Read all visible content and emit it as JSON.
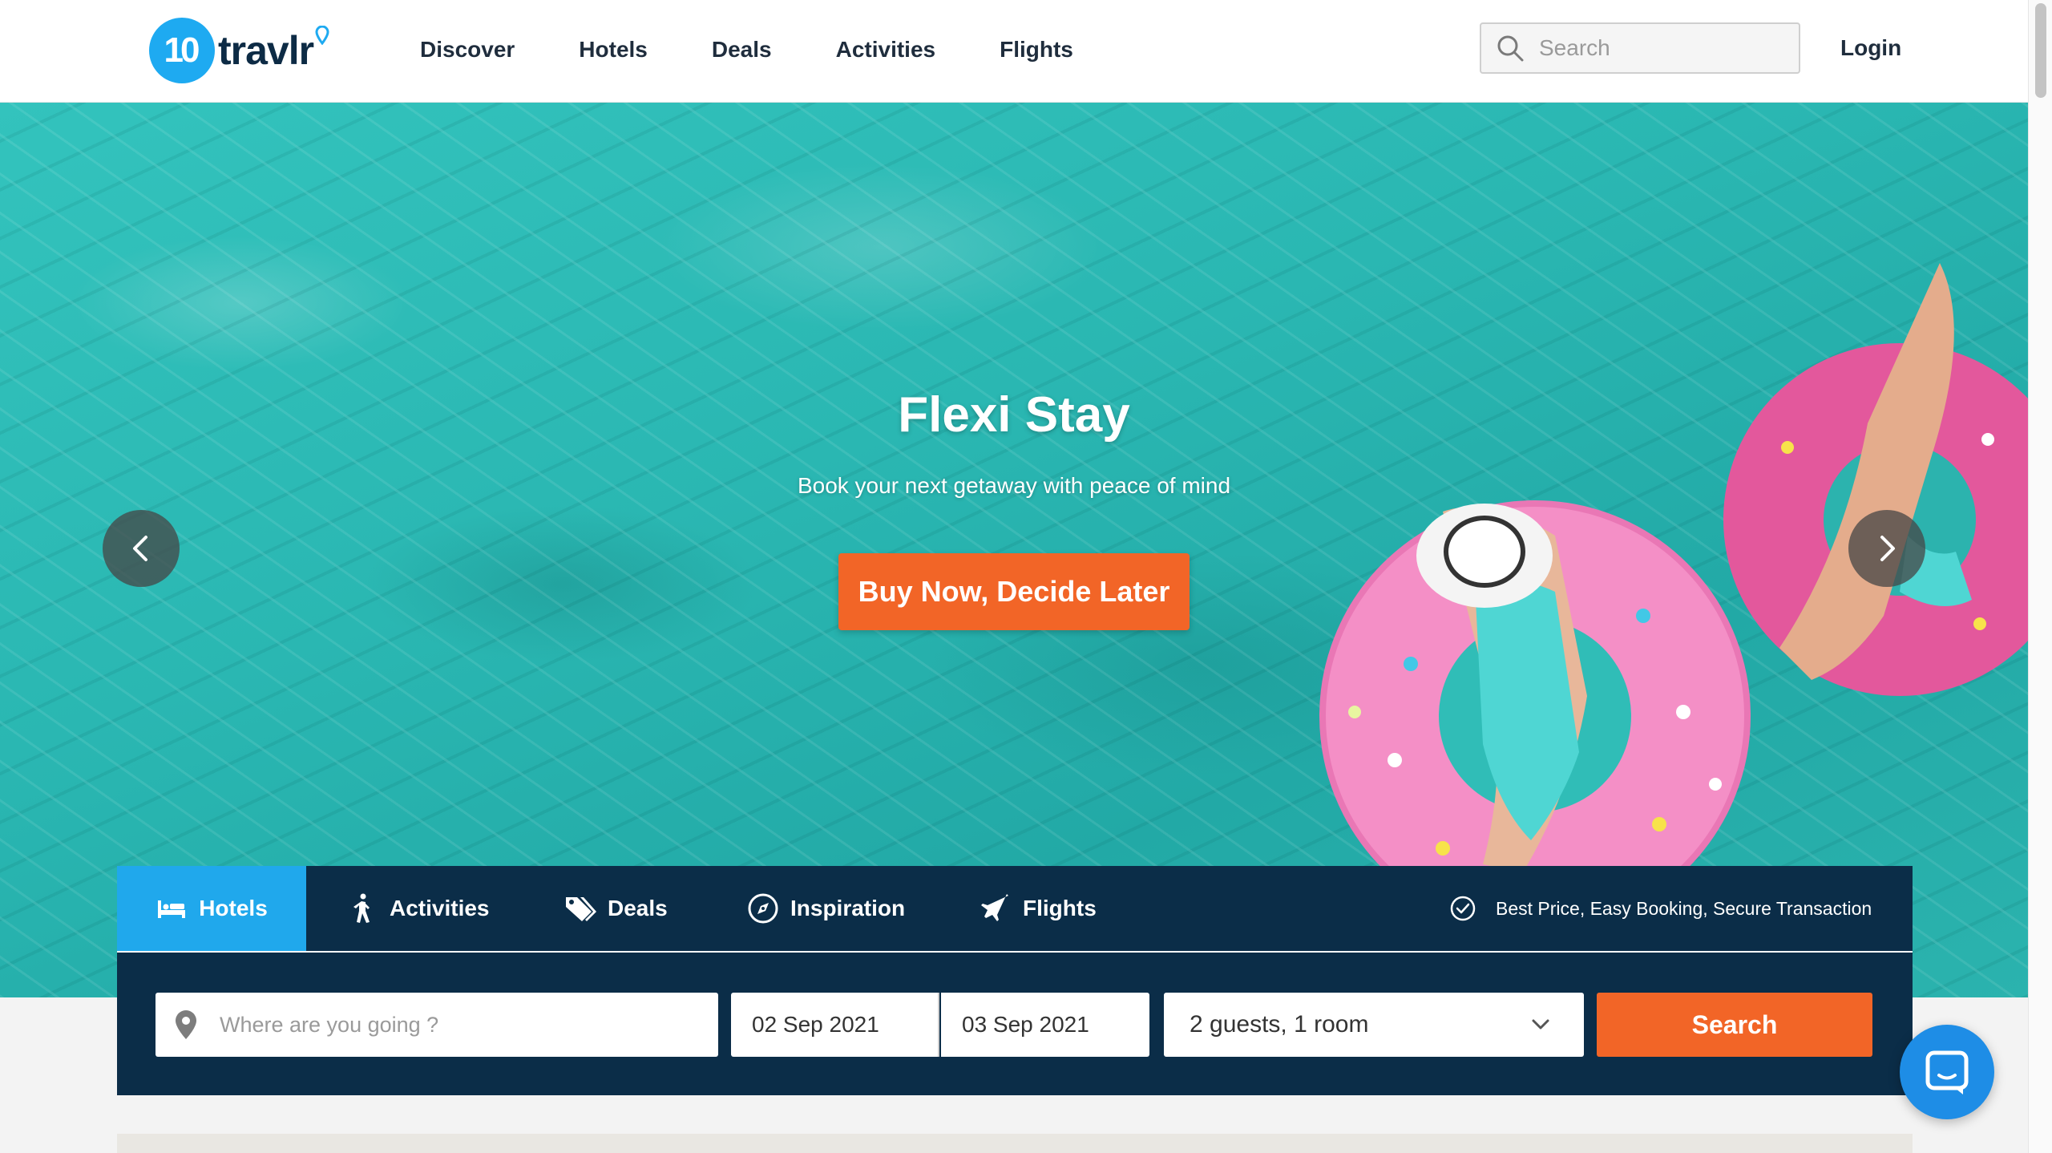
{
  "brand": {
    "logo_number": "10",
    "logo_name": "travlr",
    "primary_color": "#1eaaf1",
    "navy_color": "#0b2d48",
    "accent_color": "#f26527"
  },
  "nav": {
    "items": [
      "Discover",
      "Hotels",
      "Deals",
      "Activities",
      "Flights"
    ],
    "search_placeholder": "Search",
    "login_label": "Login"
  },
  "hero": {
    "title": "Flexi Stay",
    "subtitle": "Book your next getaway with peace of mind",
    "cta_label": "Buy Now, Decide Later",
    "prev_icon": "chevron-left-icon",
    "next_icon": "chevron-right-icon"
  },
  "booking": {
    "tabs": [
      {
        "label": "Hotels",
        "icon": "bed-icon",
        "active": true
      },
      {
        "label": "Activities",
        "icon": "walking-person-icon",
        "active": false
      },
      {
        "label": "Deals",
        "icon": "tags-icon",
        "active": false
      },
      {
        "label": "Inspiration",
        "icon": "compass-icon",
        "active": false
      },
      {
        "label": "Flights",
        "icon": "airplane-icon",
        "active": false
      }
    ],
    "promise_text": "Best Price, Easy Booking, Secure Transaction",
    "destination_placeholder": "Where are you going ?",
    "check_in": "02 Sep 2021",
    "check_out": "03 Sep 2021",
    "guests": "2 guests, 1 room",
    "search_label": "Search"
  },
  "chat": {
    "icon": "chat-bubble-icon"
  }
}
